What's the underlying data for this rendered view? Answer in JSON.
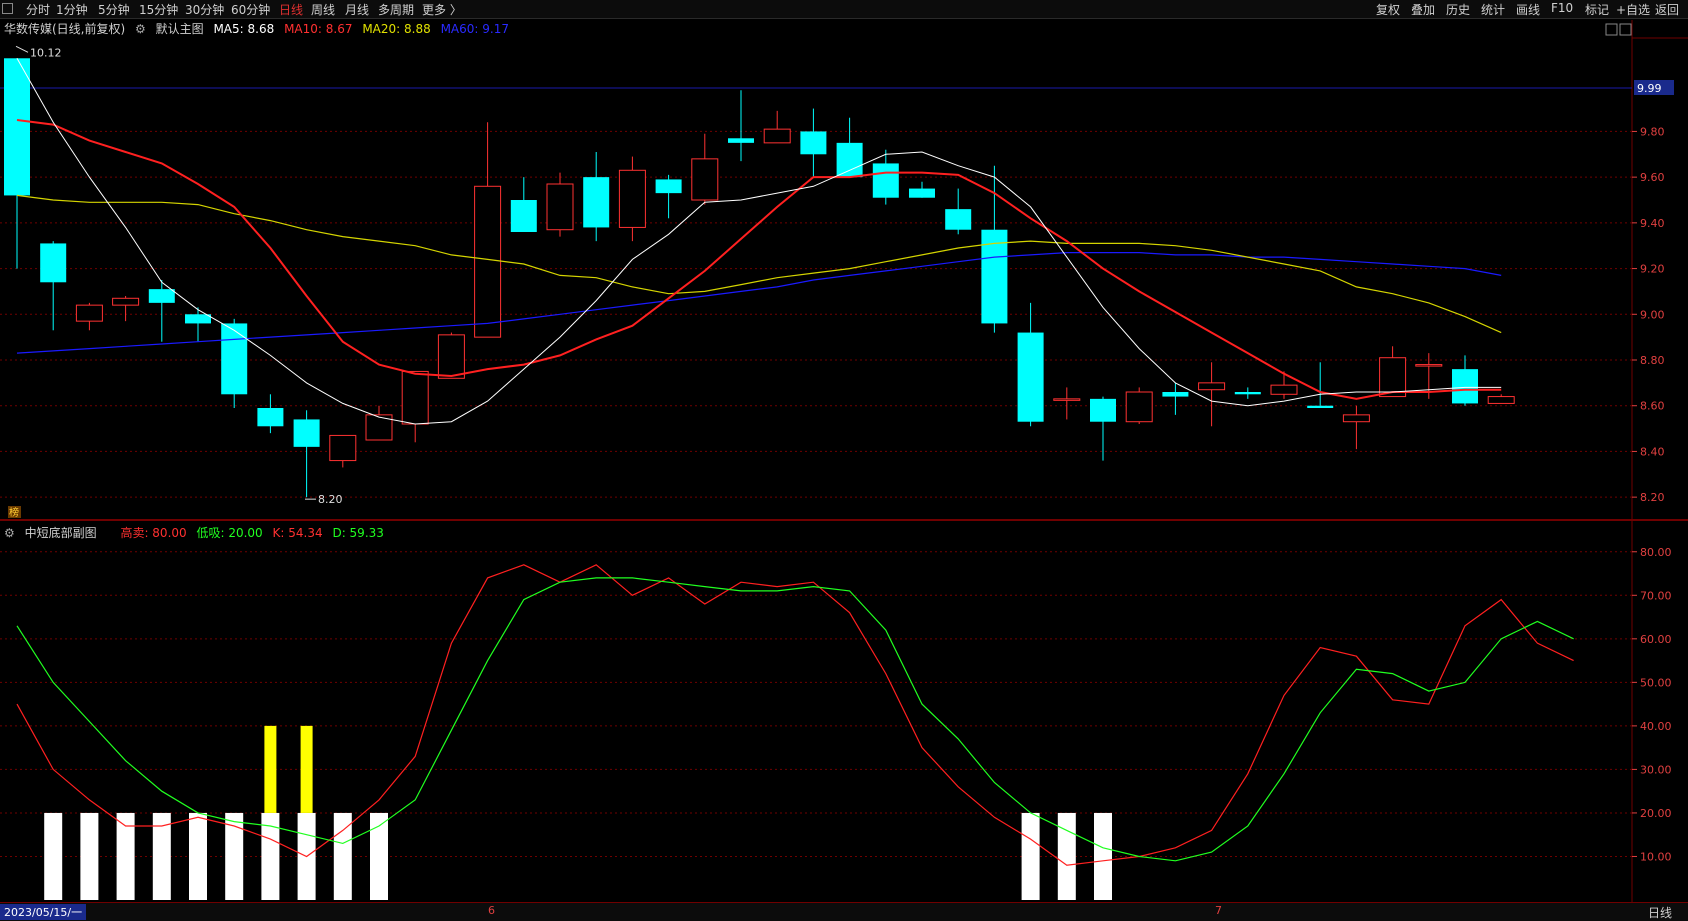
{
  "topbar": {
    "left_items": [
      "分时",
      "1分钟",
      "5分钟",
      "15分钟",
      "30分钟",
      "60分钟",
      "日线",
      "周线",
      "月线",
      "多周期",
      "更多 〉"
    ],
    "active": "日线",
    "right_items": [
      "复权",
      "叠加",
      "历史",
      "统计",
      "画线",
      "F10",
      "标记",
      "+自选",
      "返回"
    ]
  },
  "main": {
    "stock_title": "华数传媒(日线,前复权)",
    "indicator_name": "默认主图",
    "ma5": "MA5: 8.68",
    "ma10": "MA10: 8.67",
    "ma20": "MA20: 8.88",
    "ma60": "MA60: 9.17",
    "high_label": "10.12",
    "low_label": "8.20",
    "price_tag": "9.99",
    "badge": "榜",
    "y_ticks": [
      "9.80",
      "9.60",
      "9.40",
      "9.20",
      "9.00",
      "8.80",
      "8.60",
      "8.40",
      "8.20"
    ]
  },
  "sub": {
    "indicator_name": "中短底部副图",
    "high_sell": "高卖: 80.00",
    "low_buy": "低吸: 20.00",
    "k_value": "K: 54.34",
    "d_value": "D: 59.33",
    "y_ticks": [
      "80.00",
      "70.00",
      "60.00",
      "50.00",
      "40.00",
      "30.00",
      "20.00",
      "10.00"
    ]
  },
  "bottombar": {
    "date": "2023/05/15/一",
    "month_ticks": [
      "6",
      "7"
    ],
    "period": "日线"
  },
  "colors": {
    "up": "#ff3232",
    "down": "#00ffff",
    "ma5": "#ffffff",
    "ma10": "#ff2020",
    "ma20": "#d4d400",
    "ma60": "#1a1aff",
    "k": "#ff2020",
    "d": "#20ff20",
    "grid": "#700000",
    "signal_white": "#ffffff",
    "signal_yellow": "#ffff00"
  },
  "chart_data": {
    "type": "candlestick",
    "ohlc": [
      [
        10.12,
        10.12,
        9.2,
        9.52
      ],
      [
        9.31,
        9.32,
        8.93,
        9.14
      ],
      [
        8.97,
        9.05,
        8.93,
        9.04
      ],
      [
        9.04,
        9.08,
        8.97,
        9.07
      ],
      [
        9.11,
        9.15,
        8.88,
        9.05
      ],
      [
        9.0,
        9.03,
        8.88,
        8.96
      ],
      [
        8.96,
        8.98,
        8.59,
        8.65
      ],
      [
        8.59,
        8.65,
        8.48,
        8.51
      ],
      [
        8.54,
        8.58,
        8.2,
        8.42
      ],
      [
        8.36,
        8.47,
        8.33,
        8.47
      ],
      [
        8.45,
        8.6,
        8.45,
        8.56
      ],
      [
        8.52,
        8.74,
        8.44,
        8.75
      ],
      [
        8.72,
        8.92,
        8.72,
        8.91
      ],
      [
        8.9,
        9.84,
        8.9,
        9.56
      ],
      [
        9.5,
        9.6,
        9.37,
        9.36
      ],
      [
        9.37,
        9.62,
        9.34,
        9.57
      ],
      [
        9.6,
        9.71,
        9.32,
        9.38
      ],
      [
        9.38,
        9.69,
        9.32,
        9.63
      ],
      [
        9.59,
        9.61,
        9.42,
        9.53
      ],
      [
        9.5,
        9.79,
        9.48,
        9.68
      ],
      [
        9.77,
        9.98,
        9.67,
        9.75
      ],
      [
        9.75,
        9.89,
        9.76,
        9.81
      ],
      [
        9.8,
        9.9,
        9.6,
        9.7
      ],
      [
        9.75,
        9.86,
        9.6,
        9.6
      ],
      [
        9.66,
        9.72,
        9.48,
        9.51
      ],
      [
        9.55,
        9.58,
        9.51,
        9.51
      ],
      [
        9.46,
        9.55,
        9.35,
        9.37
      ],
      [
        9.37,
        9.65,
        8.92,
        8.96
      ],
      [
        8.92,
        9.05,
        8.51,
        8.53
      ],
      [
        8.63,
        8.68,
        8.54,
        8.63
      ],
      [
        8.63,
        8.64,
        8.36,
        8.53
      ],
      [
        8.53,
        8.68,
        8.52,
        8.66
      ],
      [
        8.66,
        8.7,
        8.56,
        8.64
      ],
      [
        8.67,
        8.79,
        8.51,
        8.7
      ],
      [
        8.66,
        8.68,
        8.63,
        8.65
      ],
      [
        8.65,
        8.75,
        8.63,
        8.69
      ],
      [
        8.6,
        8.79,
        8.6,
        8.59
      ],
      [
        8.53,
        8.6,
        8.41,
        8.56
      ],
      [
        8.64,
        8.86,
        8.64,
        8.81
      ],
      [
        8.78,
        8.83,
        8.63,
        8.78
      ],
      [
        8.76,
        8.82,
        8.6,
        8.61
      ],
      [
        8.61,
        8.65,
        8.61,
        8.64
      ]
    ],
    "ma5": [
      10.12,
      9.84,
      9.6,
      9.38,
      9.14,
      9.02,
      8.93,
      8.82,
      8.7,
      8.61,
      8.55,
      8.52,
      8.53,
      8.62,
      8.76,
      8.9,
      9.06,
      9.24,
      9.35,
      9.49,
      9.5,
      9.53,
      9.56,
      9.63,
      9.7,
      9.71,
      9.65,
      9.6,
      9.47,
      9.25,
      9.03,
      8.85,
      8.7,
      8.62,
      8.6,
      8.62,
      8.65,
      8.66,
      8.66,
      8.67,
      8.68,
      8.68
    ],
    "ma10": [
      9.85,
      9.83,
      9.76,
      9.71,
      9.66,
      9.57,
      9.47,
      9.29,
      9.08,
      8.88,
      8.78,
      8.74,
      8.73,
      8.76,
      8.78,
      8.82,
      8.89,
      8.95,
      9.07,
      9.19,
      9.33,
      9.47,
      9.6,
      9.6,
      9.62,
      9.62,
      9.61,
      9.53,
      9.42,
      9.32,
      9.2,
      9.1,
      9.01,
      8.92,
      8.83,
      8.74,
      8.66,
      8.63,
      8.66,
      8.66,
      8.67,
      8.67
    ],
    "ma20": [
      9.52,
      9.5,
      9.49,
      9.49,
      9.49,
      9.48,
      9.44,
      9.41,
      9.37,
      9.34,
      9.32,
      9.3,
      9.26,
      9.24,
      9.22,
      9.17,
      9.16,
      9.12,
      9.09,
      9.1,
      9.13,
      9.16,
      9.18,
      9.2,
      9.23,
      9.26,
      9.29,
      9.31,
      9.32,
      9.31,
      9.31,
      9.31,
      9.3,
      9.28,
      9.25,
      9.22,
      9.19,
      9.12,
      9.09,
      9.05,
      8.99,
      8.92
    ],
    "ma60": [
      8.83,
      8.84,
      8.85,
      8.86,
      8.87,
      8.88,
      8.89,
      8.9,
      8.91,
      8.92,
      8.93,
      8.94,
      8.95,
      8.96,
      8.98,
      9.0,
      9.02,
      9.04,
      9.06,
      9.08,
      9.1,
      9.12,
      9.15,
      9.17,
      9.19,
      9.21,
      9.23,
      9.25,
      9.26,
      9.27,
      9.27,
      9.27,
      9.26,
      9.26,
      9.25,
      9.25,
      9.24,
      9.23,
      9.22,
      9.21,
      9.2,
      9.17
    ],
    "k": [
      45,
      30,
      23,
      17,
      17,
      19,
      17,
      14,
      10,
      16,
      23,
      33,
      59,
      74,
      77,
      73,
      77,
      70,
      74,
      68,
      73,
      72,
      73,
      66,
      52,
      35,
      26,
      19,
      14,
      8,
      9,
      10,
      12,
      16,
      29,
      47,
      58,
      56,
      46,
      45,
      63,
      69,
      59,
      55
    ],
    "d": [
      63,
      50,
      41,
      32,
      25,
      20,
      18,
      17,
      15,
      13,
      17,
      23,
      39,
      55,
      69,
      73,
      74,
      74,
      73,
      72,
      71,
      71,
      72,
      71,
      62,
      45,
      37,
      27,
      20,
      16,
      12,
      10,
      9,
      11,
      17,
      29,
      43,
      53,
      52,
      48,
      50,
      60,
      64,
      60
    ],
    "ylim_main": [
      8.1,
      10.2
    ],
    "ylim_sub": [
      0,
      85
    ],
    "white_signal_bars": [
      1,
      2,
      3,
      4,
      5,
      6,
      7,
      8,
      9,
      10,
      28,
      29,
      30
    ],
    "yellow_signal_bars": [
      7,
      8
    ]
  }
}
